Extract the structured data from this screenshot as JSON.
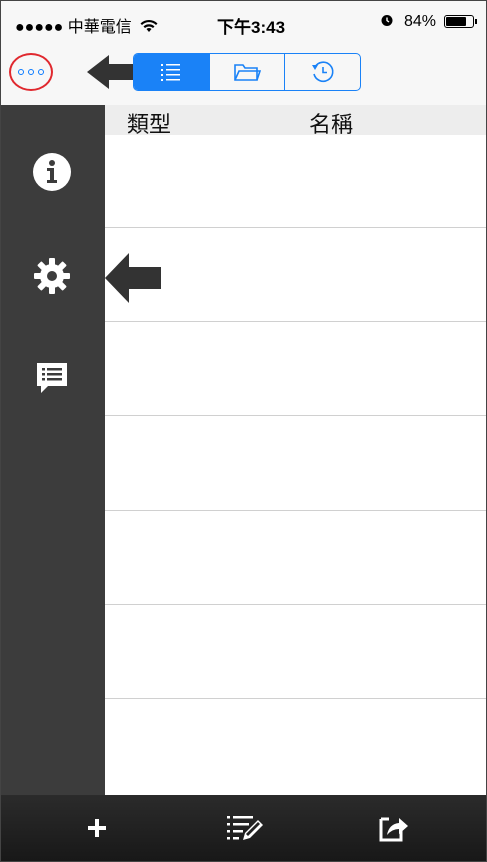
{
  "status_bar": {
    "carrier": "●●●●● 中華電信",
    "time": "下午3:43",
    "battery": "84%",
    "battery_level": 0.84
  },
  "nav": {
    "more_icon": "more-icon",
    "segments": [
      {
        "icon": "list-icon",
        "selected": true
      },
      {
        "icon": "folder-icon",
        "selected": false
      },
      {
        "icon": "history-icon",
        "selected": false
      }
    ]
  },
  "sidebar": {
    "items": [
      {
        "icon": "info-icon"
      },
      {
        "icon": "gear-icon"
      },
      {
        "icon": "message-icon"
      }
    ]
  },
  "table": {
    "columns": [
      "類型",
      "名稱"
    ]
  },
  "toolbar": {
    "items": [
      {
        "icon": "plus-icon"
      },
      {
        "icon": "edit-list-icon"
      },
      {
        "icon": "share-icon"
      }
    ]
  },
  "colors": {
    "accent": "#1a82f7",
    "highlight_circle": "#e0282e",
    "sidebar_bg": "#3c3c3c",
    "toolbar_bg": "#1e1e1e"
  }
}
